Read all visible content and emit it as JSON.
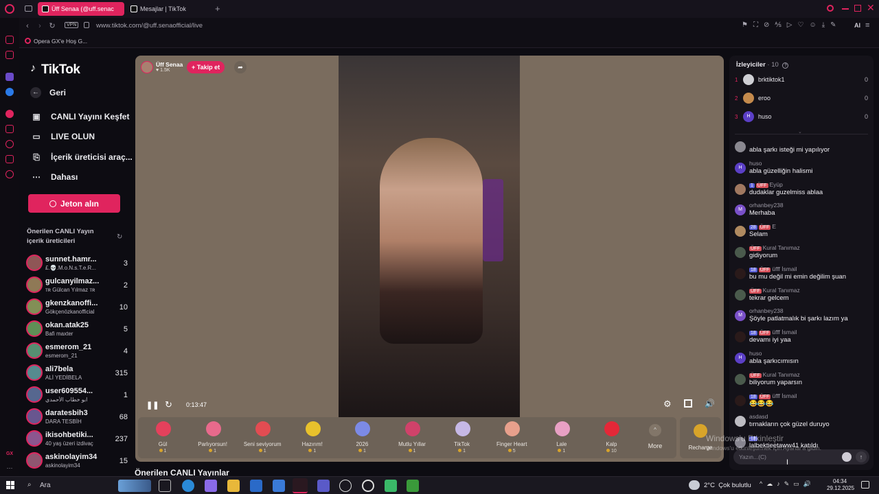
{
  "browser": {
    "tabs": [
      {
        "label": "Üff Senaa (@uff.senac"
      },
      {
        "label": "Mesajlar | TikTok"
      }
    ],
    "new_tab": "+",
    "vpn": "VPN",
    "url": "www.tiktok.com/@uff.senaofficial/live",
    "bookmark": "Opera GX'e Hoş G...",
    "ai": "AI"
  },
  "tiktok": {
    "logo": "TikTok",
    "nav": [
      {
        "label": "Geri",
        "icon": "arrow-left-icon"
      },
      {
        "label": "CANLI Yayını Keşfet",
        "icon": "live-icon"
      },
      {
        "label": "LIVE OLUN",
        "icon": "video-icon"
      },
      {
        "label": "İçerik üreticisi araç...",
        "icon": "creator-tools-icon"
      },
      {
        "label": "Dahası",
        "icon": "more-icon"
      }
    ],
    "jeton_button": "Jeton alın",
    "suggested_title": "Önerilen CANLI Yayın içerik üreticileri",
    "creators": [
      {
        "name": "sunnet.hamr...",
        "sub": "£.💀.M.o.N.s.T.e.R...",
        "count": "3"
      },
      {
        "name": "gulcanyilmaz...",
        "sub": "ᴛʀ Gülcan Yılmaz ᴛʀ",
        "count": "2"
      },
      {
        "name": "gkenzkanoffi...",
        "sub": "Gökçenözkanofficial",
        "count": "10"
      },
      {
        "name": "okan.atak25",
        "sub": "Bafi maxter",
        "count": "5"
      },
      {
        "name": "esmerom_21",
        "sub": "esmerom_21",
        "count": "4"
      },
      {
        "name": "ali7bela",
        "sub": "ALİ YEDİBELA",
        "count": "315"
      },
      {
        "name": "user609554...",
        "sub": "ابو خطاب الأحمدي",
        "count": "1"
      },
      {
        "name": "daratesbih3",
        "sub": "DARA TESBİH",
        "count": "68"
      },
      {
        "name": "ikisohbetiki...",
        "sub": "40 yaş üzeri izdivaç",
        "count": "237"
      },
      {
        "name": "askinolayim34",
        "sub": "askinolayim34",
        "count": "15"
      }
    ],
    "bottom_heading": "Önerilen CANLI Yayınlar"
  },
  "stream": {
    "host_name": "Üff Senaa",
    "host_likes": "1.5K",
    "follow_button": "+ Takip et",
    "elapsed": "0:13:47",
    "gifts": [
      {
        "name": "Gül",
        "price": "1",
        "color": "#e4415c"
      },
      {
        "name": "Parlıyorsun!",
        "price": "1",
        "color": "#e86a8c"
      },
      {
        "name": "Seni seviyorum",
        "price": "1",
        "color": "#e24c52"
      },
      {
        "name": "Hazırım!",
        "price": "1",
        "color": "#e8c12c"
      },
      {
        "name": "2026",
        "price": "1",
        "color": "#7c8ae6"
      },
      {
        "name": "Mutlu Yıllar",
        "price": "1",
        "color": "#d0426a"
      },
      {
        "name": "TikTok",
        "price": "1",
        "color": "#c6b8e6"
      },
      {
        "name": "Finger Heart",
        "price": "5",
        "color": "#e8a08c"
      },
      {
        "name": "Lale",
        "price": "1",
        "color": "#e8a0c4"
      },
      {
        "name": "Kalp",
        "price": "10",
        "color": "#e42838"
      }
    ],
    "more_label": "More",
    "recharge_label": "Recharge"
  },
  "viewers": {
    "title": "İzleyiciler",
    "count": "10",
    "list": [
      {
        "rank": "1",
        "name": "brktiktok1",
        "score": "0",
        "color": "#cfcfd4"
      },
      {
        "rank": "2",
        "name": "eroo",
        "score": "0",
        "color": "#c48a4c"
      },
      {
        "rank": "3",
        "name": "huso",
        "score": "0",
        "color": "#5b3fc6",
        "initial": "H"
      }
    ]
  },
  "chat": {
    "messages": [
      {
        "user": "",
        "text": "abla şarkı isteği mi yapılıyor",
        "avatar": "#8a8890"
      },
      {
        "user": "huso",
        "text": "abla güzelliğin halismi",
        "avatar": "#5b3fc6",
        "initial": "H"
      },
      {
        "user": "Eyüp",
        "text": "dudaklar guzelmiss ablaa",
        "avatar": "#a07860",
        "badges": [
          "1",
          "ÜFF"
        ]
      },
      {
        "user": "orhanbey238",
        "text": "Merhaba",
        "avatar": "#7a50c8",
        "initial": "M"
      },
      {
        "user": "E",
        "text": "Selam",
        "avatar": "#b08a60",
        "badges": [
          "28",
          "ÜFF"
        ]
      },
      {
        "user": "Kural Tanımaz",
        "text": "gidiyorum",
        "avatar": "#4a5a4c",
        "badges": [
          "ÜFF"
        ]
      },
      {
        "user": "üfff İsmail",
        "text": "bu mu değil mi emin değilim şuan",
        "avatar": "#2a1a1a",
        "badges": [
          "18",
          "ÜFF"
        ]
      },
      {
        "user": "Kural Tanımaz",
        "text": "tekrar gelcem",
        "avatar": "#4a5a4c",
        "badges": [
          "ÜFF"
        ]
      },
      {
        "user": "orhanbey238",
        "text": "Şöyle patlatmalık bi şarkı lazım ya",
        "avatar": "#7a50c8",
        "initial": "M"
      },
      {
        "user": "üfff İsmail",
        "text": "devamı iyi yaa",
        "avatar": "#2a1a1a",
        "badges": [
          "18",
          "ÜFF"
        ]
      },
      {
        "user": "huso",
        "text": "abla şarkıcımısın",
        "avatar": "#5b3fc6",
        "initial": "H"
      },
      {
        "user": "Kural Tanımaz",
        "text": "biliyorum yaparsın",
        "avatar": "#4a5a4c",
        "badges": [
          "ÜFF"
        ]
      },
      {
        "user": "üfff İsmail",
        "text": "😂😂😂",
        "avatar": "#2a1a1a",
        "badges": [
          "18",
          "ÜFF"
        ]
      },
      {
        "user": "asdasd",
        "text": "tırnakların çok güzel duruyo",
        "avatar": "#bdbcc2"
      },
      {
        "user": "",
        "text": "lalbektieetaww41 katıldı",
        "avatar": "#888690",
        "badges": [
          "18"
        ]
      }
    ],
    "input_placeholder": "Yazın...(C)"
  },
  "watermark": {
    "line1": "Windows'u Etkinleştir",
    "line2": "Windows'u etkinleştirmek için Ayarlar'a gidin."
  },
  "taskbar": {
    "search": "Ara",
    "weather": "2°C  Çok bulutlu",
    "time": "04:34",
    "date": "29.12.2025"
  }
}
